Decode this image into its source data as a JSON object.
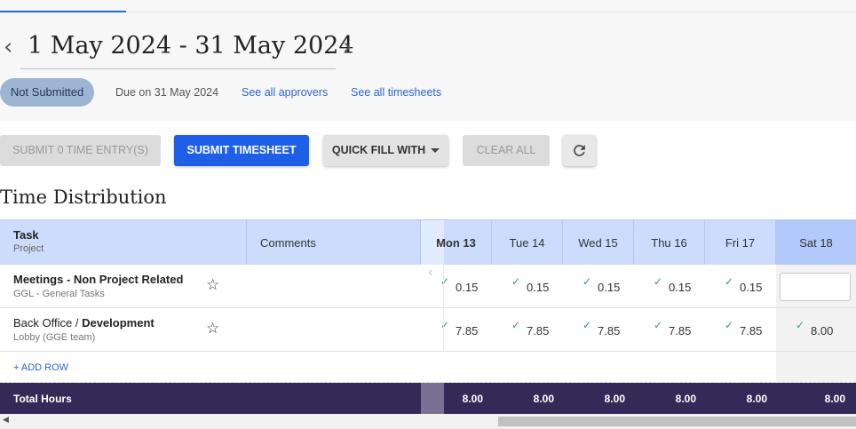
{
  "header": {
    "prev_arrow": "‹",
    "next_arrow": "›",
    "date_range": "1 May 2024 - 31 May 2024",
    "status": "Not Submitted",
    "due": "Due on 31 May 2024",
    "link_approvers": "See all approvers",
    "link_timesheets": "See all timesheets"
  },
  "toolbar": {
    "submit_entries": "SUBMIT 0 TIME ENTRY(S)",
    "submit_timesheet": "SUBMIT TIMESHEET",
    "quick_fill": "QUICK FILL WITH",
    "clear_all": "CLEAR ALL",
    "refresh_icon": "refresh-icon"
  },
  "section_title": "Time Distribution",
  "table": {
    "task_header": "Task",
    "project_header": "Project",
    "comments_header": "Comments",
    "days": [
      "Mon 13",
      "Tue 14",
      "Wed 15",
      "Thu 16",
      "Fri 17",
      "Sat 18"
    ],
    "rows": [
      {
        "name_prefix": "",
        "name_bold": "Meetings - Non Project Related",
        "project": "GGL - General Tasks",
        "values": [
          "0.15",
          "0.15",
          "0.15",
          "0.15",
          "0.15"
        ]
      },
      {
        "name_prefix": "Back Office / ",
        "name_bold": "Development",
        "project": "Lobby (GGE team)",
        "values": [
          "7.85",
          "7.85",
          "7.85",
          "7.85",
          "7.85",
          "8.00"
        ]
      }
    ],
    "add_row": "+ ADD ROW",
    "total_label": "Total Hours",
    "totals": [
      "8.00",
      "8.00",
      "8.00",
      "8.00",
      "8.00",
      "8.00"
    ],
    "check_glyph": "✓",
    "star_glyph": "☆",
    "collapse_glyph": "‹"
  },
  "colors": {
    "primary": "#1f5fe8",
    "header_bg": "#cddcfc",
    "total_bg": "#352a57",
    "status_badge": "#9db4d3",
    "check": "#2ca35a"
  }
}
